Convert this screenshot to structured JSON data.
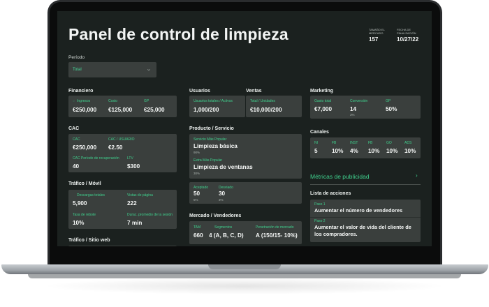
{
  "header": {
    "title": "Panel de control de limpieza",
    "market_size_label": "TAMAÑO EL MERCADO",
    "market_size_value": "157",
    "end_date_label": "FECHA DE FINALIZACIÓN",
    "end_date_value": "10/27/22"
  },
  "period": {
    "label": "Período",
    "value": "Total"
  },
  "financiero": {
    "title": "Financiero",
    "ingresos_label": "Ingresos",
    "ingresos_value": "€250,000",
    "costo_label": "Costo",
    "costo_value": "€125,000",
    "gp_label": "GP",
    "gp_value": "€25,000"
  },
  "usuarios": {
    "title": "Usuarios",
    "label": "Usuarios totales / Activos",
    "value": "1,000/200"
  },
  "ventas": {
    "title": "Ventas",
    "label": "Total / Unidades",
    "value": "€10,000/200"
  },
  "marketing": {
    "title": "Marketing",
    "gasto_label": "Gasto total",
    "gasto_value": "€7,000",
    "conversion_label": "Conversión",
    "conversion_value": "14",
    "conversion_sub": "3%",
    "gp_label": "GP",
    "gp_value": "50%"
  },
  "cac": {
    "title": "CAC",
    "cac_label": "CAC",
    "cac_value": "€250,000",
    "cac_usuario_label": "CAC / USUARIO",
    "cac_usuario_value": "€2.50",
    "recuperacion_label": "CAC Período de recuperación",
    "recuperacion_value": "40",
    "ltv_label": "LTV",
    "ltv_value": "$300"
  },
  "producto": {
    "title": "Producto / Servicio",
    "item1_label": "Servicio Más Popular",
    "item1_value": "Limpieza básica",
    "item1_sub": "90%",
    "item2_label": "Extra Más Popular",
    "item2_value": "Limpieza de ventanas",
    "item2_sub": "30%",
    "aceptado_label": "Aceptado",
    "aceptado_value": "50",
    "aceptado_sub": "5%",
    "desviado_label": "Desviado",
    "desviado_value": "30",
    "desviado_sub": "3%"
  },
  "canales": {
    "title": "Canales",
    "items": [
      {
        "label": "NI",
        "value": "5"
      },
      {
        "label": "FB",
        "value": "10%"
      },
      {
        "label": "INST",
        "value": "4%"
      },
      {
        "label": "FB",
        "value": "10%"
      },
      {
        "label": "GO",
        "value": "10%"
      },
      {
        "label": "ADS",
        "value": "10%"
      }
    ]
  },
  "metricas": {
    "label": "Métricas de publicidad"
  },
  "trafico_movil": {
    "title": "Tráfico / Móvil",
    "descargas_label": "Descargas totales",
    "descargas_value": "5,900",
    "vistas_label": "Vistas de página",
    "vistas_value": "222",
    "rebote_label": "Tasa de rebote",
    "rebote_value": "10%",
    "duracion_label": "Durac. promedio de la sesión",
    "duracion_value": "7 min"
  },
  "mercado": {
    "title": "Mercado / Vendedores",
    "tam_label": "TAM",
    "tam_value": "660",
    "segmentos_label": "Segmentos",
    "segmentos_value": "4 (A, B, C, D)",
    "penetracion_label": "Penetración de mercado",
    "penetracion_value": "A (150/15- 10%)"
  },
  "acciones": {
    "title": "Lista de acciones",
    "step1_label": "Paso 1",
    "step1_value": "Aumentar el número de vendedores",
    "step2_label": "Paso 2",
    "step2_value": "Aumentar el valor de vida del cliente de los compradores."
  },
  "trafico_web": {
    "title": "Tráfico / Sitio web"
  },
  "colors": {
    "accent": "#3fd08d",
    "screen_bg": "#1b211f",
    "card_bg": "#3a3f3d"
  }
}
